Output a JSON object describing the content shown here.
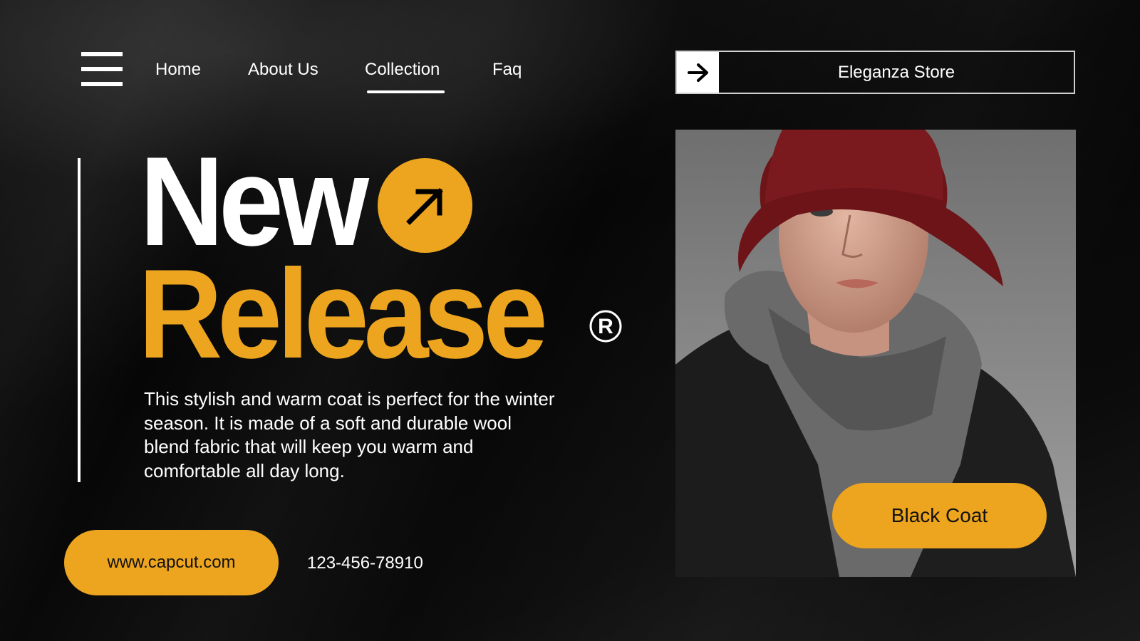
{
  "nav": {
    "items": [
      {
        "label": "Home"
      },
      {
        "label": "About Us"
      },
      {
        "label": "Collection",
        "active": true
      },
      {
        "label": "Faq"
      }
    ]
  },
  "store": {
    "name": "Eleganza Store"
  },
  "headline": {
    "line1": "New",
    "line2": "Release"
  },
  "description": "This stylish and warm coat is perfect for the winter\n season. It is made of a soft and durable wool\nblend fabric that will keep you warm and\ncomfortable all day long.",
  "contact": {
    "url": "www.capcut.com",
    "phone": "123-456-78910"
  },
  "product": {
    "label": "Black Coat"
  },
  "icons": {
    "menu": "hamburger-menu-icon",
    "store_arrow": "arrow-right-icon",
    "headline_arrow": "arrow-up-right-icon",
    "registered": "registered-trademark-icon"
  },
  "colors": {
    "accent": "#eda51f",
    "background": "#050505",
    "text": "#ffffff"
  }
}
